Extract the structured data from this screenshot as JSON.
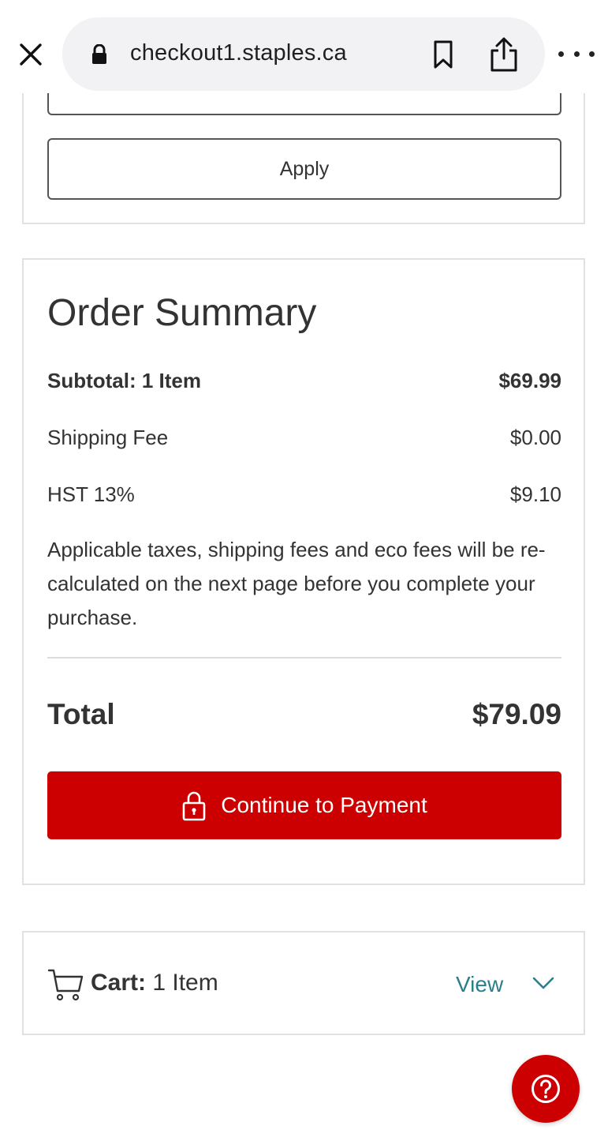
{
  "browser": {
    "url": "checkout1.staples.ca",
    "icons": [
      "close-icon",
      "lock-icon",
      "bookmark-icon",
      "share-icon",
      "more-icon"
    ]
  },
  "promo": {
    "apply_label": "Apply"
  },
  "summary": {
    "title": "Order Summary",
    "rows": [
      {
        "label": "Subtotal: 1 Item",
        "value": "$69.99"
      },
      {
        "label": "Shipping Fee",
        "value": "$0.00"
      },
      {
        "label": "HST 13%",
        "value": "$9.10"
      }
    ],
    "note": "Applicable taxes, shipping fees and eco fees will be re-calculated on the next page before you complete your purchase.",
    "total_label": "Total",
    "total_value": "$79.09",
    "pay_label": "Continue to Payment"
  },
  "cart": {
    "label_bold": "Cart:",
    "label_rest": " 1 Item",
    "view_label": "View"
  },
  "colors": {
    "brand_red": "#cc0000",
    "link_teal": "#2b7f8c"
  }
}
